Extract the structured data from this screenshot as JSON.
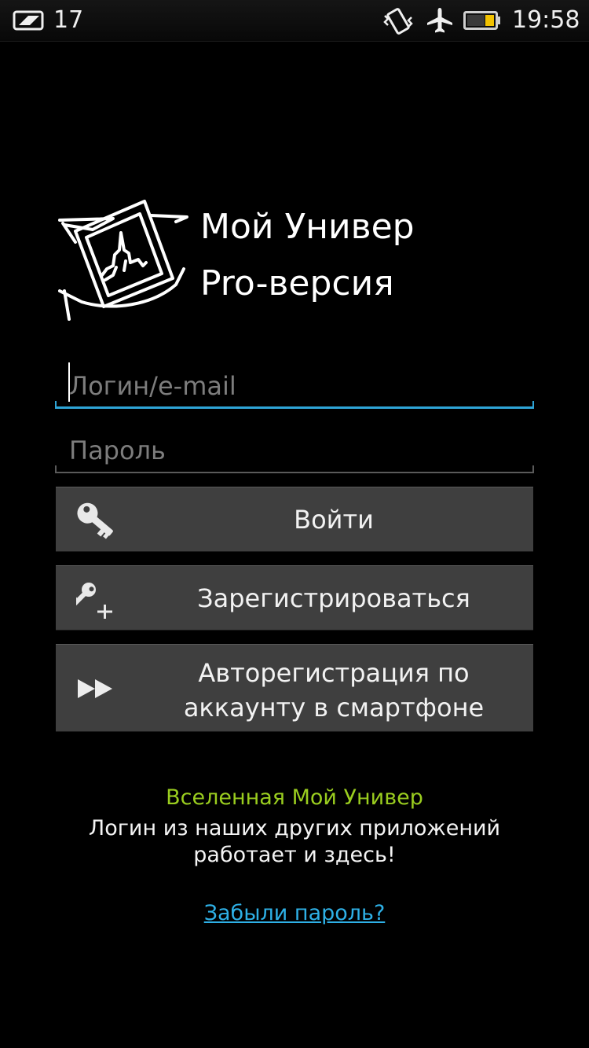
{
  "status_bar": {
    "notification_count": "17",
    "time": "19:58",
    "icons": [
      "notification-card-icon",
      "vibrate-icon",
      "airplane-icon",
      "battery-icon"
    ]
  },
  "app": {
    "title": "Мой Универ",
    "subtitle": "Pro-версия",
    "logo_icon": "university-building-logo-icon"
  },
  "form": {
    "login_placeholder": "Логин/e-mail",
    "login_value": "",
    "password_placeholder": "Пароль",
    "password_value": ""
  },
  "buttons": {
    "login": {
      "label": "Войти",
      "icon": "key-icon"
    },
    "register": {
      "label": "Зарегистрироваться",
      "icon": "key-plus-icon"
    },
    "autoreg": {
      "label_line1": "Авторегистрация по",
      "label_line2": "аккаунту в смартфоне",
      "icon": "fast-forward-icon"
    }
  },
  "footer": {
    "universe_title": "Вселенная Мой Универ",
    "universe_line1": "Логин из наших других приложений",
    "universe_line2": "работает и здесь!",
    "forgot_password": "Забыли пароль?"
  },
  "colors": {
    "background": "#000000",
    "accent_blue": "#2ea4d6",
    "link_blue": "#2eb0e6",
    "universe_green": "#9acd1f",
    "button_gray": "#3f3f3f"
  }
}
